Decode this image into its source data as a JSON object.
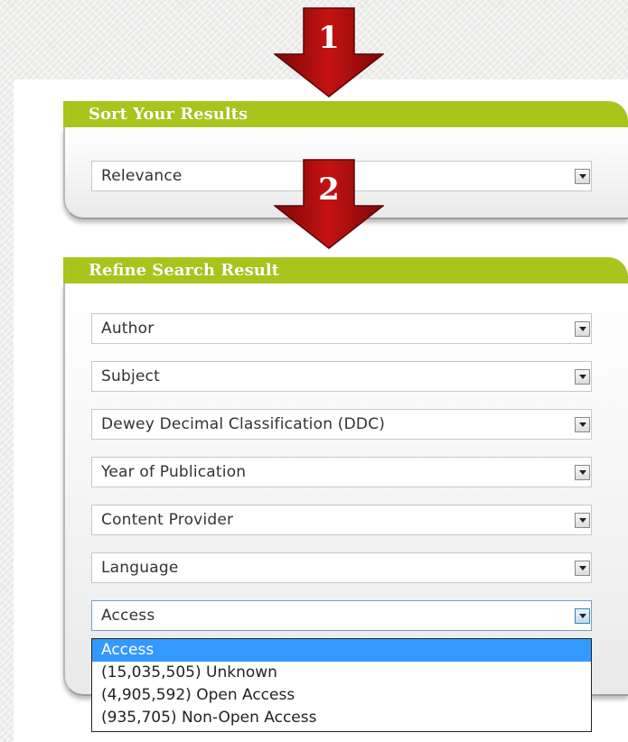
{
  "colors": {
    "header_green": "#a9c41b",
    "arrow_red": "#b30d0d",
    "highlight_blue": "#3399ff"
  },
  "callouts": [
    "1",
    "2"
  ],
  "sort": {
    "title": "Sort Your Results",
    "selected": "Relevance"
  },
  "refine": {
    "title": "Refine Search Result",
    "filters": [
      "Author",
      "Subject",
      "Dewey Decimal Classification (DDC)",
      "Year of Publication",
      "Content Provider",
      "Language"
    ],
    "access": {
      "selected": "Access",
      "options": [
        "Access",
        "(15,035,505) Unknown",
        "(4,905,592) Open Access",
        "(935,705) Non-Open Access"
      ]
    }
  }
}
